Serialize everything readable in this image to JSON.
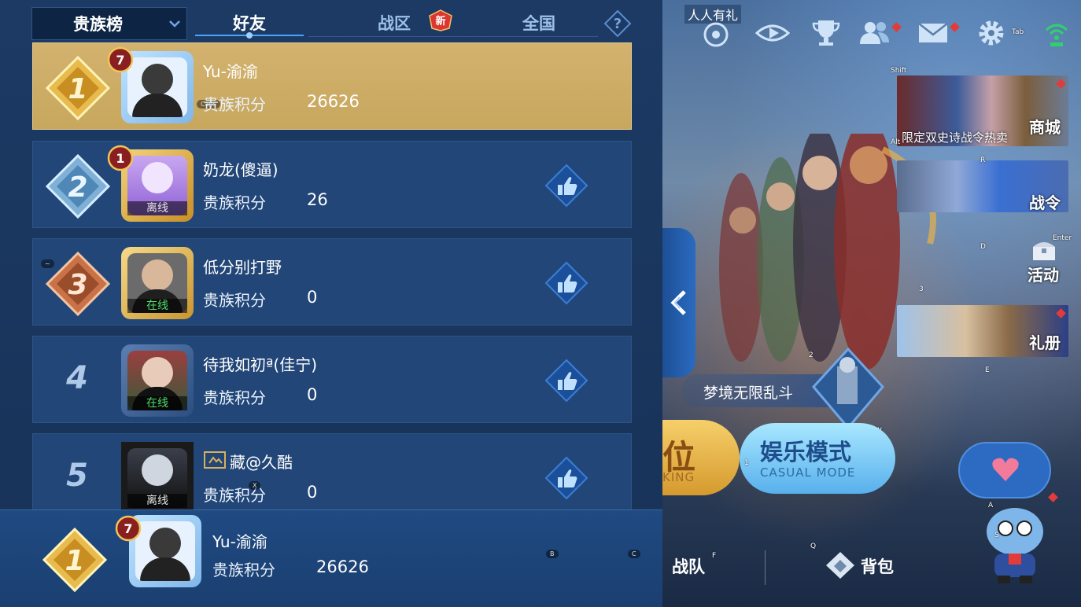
{
  "header": {
    "board_select": "贵族榜",
    "tabs": [
      "好友",
      "战区",
      "全国"
    ],
    "active_tab": "好友",
    "new_badge": "新"
  },
  "rows": [
    {
      "rank": "1",
      "level": "7",
      "name": "Yu-渝渝",
      "score_label": "贵族积分",
      "score": "26626",
      "status": "",
      "caps_hint": "Caps"
    },
    {
      "rank": "2",
      "level": "1",
      "name": "奶龙(傻逼)",
      "score_label": "贵族积分",
      "score": "26",
      "status": "离线"
    },
    {
      "rank": "3",
      "level": "",
      "name": "低分别打野",
      "score_label": "贵族积分",
      "score": "0",
      "status": "在线"
    },
    {
      "rank": "4",
      "level": "",
      "name": "待我如初ª(佳宁)",
      "score_label": "贵族积分",
      "score": "0",
      "status": "在线"
    },
    {
      "rank": "5",
      "level": "",
      "name": "藏@久酷",
      "score_label": "贵族积分",
      "score": "0",
      "status": "离线"
    }
  ],
  "self": {
    "rank": "1",
    "level": "7",
    "name": "Yu-渝渝",
    "score_label": "贵族积分",
    "score": "26626"
  },
  "lobby": {
    "banner_text": "人人有礼",
    "tab_hint": "Tab",
    "shift_hint": "Shift",
    "alt_hint": "Alt",
    "enter_hint": "Enter",
    "shop_label": "商城",
    "shop_promo": "限定双史诗战令热卖",
    "pass_label": "战令",
    "event_label": "活动",
    "gift_label": "礼册",
    "dream_mode": "梦境无限乱斗",
    "ranked_big": "位",
    "ranked_small": "KING",
    "casual_big": "娱乐模式",
    "casual_small": "CASUAL MODE",
    "team_label": "战队",
    "bag_label": "背包",
    "key_hints": [
      "R",
      "D",
      "3",
      "2",
      "E",
      "W",
      "1",
      "A",
      "S",
      "Q",
      "F",
      "B",
      "C",
      "X",
      "~"
    ]
  },
  "colors": {
    "first_row_gold": "#d2b26e",
    "row_blue": "#224677",
    "online_green": "#4be06a",
    "like_blue": "#2f6fd0"
  }
}
